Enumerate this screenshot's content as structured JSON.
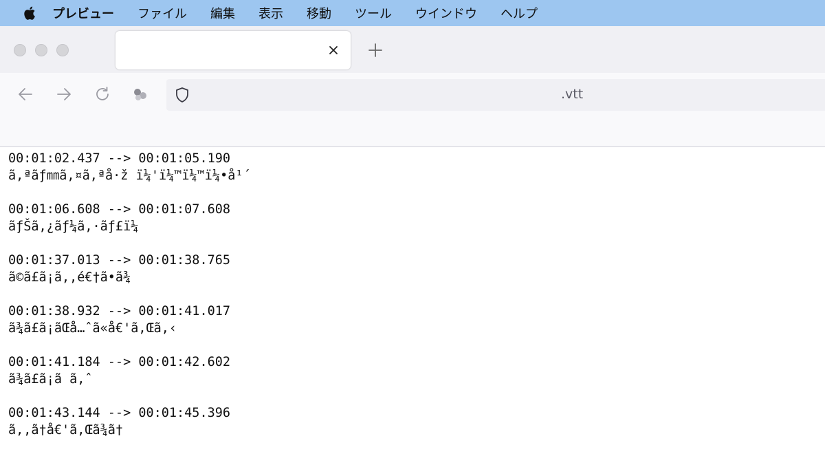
{
  "menubar": {
    "apple_icon": "apple-icon",
    "app_name": "プレビュー",
    "items": [
      "ファイル",
      "編集",
      "表示",
      "移動",
      "ツール",
      "ウインドウ",
      "ヘルプ"
    ]
  },
  "browser": {
    "tab": {
      "title": ""
    },
    "url": ".vtt"
  },
  "subtitles": [
    {
      "time": "00:01:02.437 --> 00:01:05.190",
      "text": "ã,ªãƒ㎜ã,¤ã,ªå·ž ï¼'ï¼™ï¼™ï¼•å¹´"
    },
    {
      "time": "00:01:06.608 --> 00:01:07.608",
      "text": "ãƒŠã,¿ãƒ¼ã,·ãƒ£ï¼"
    },
    {
      "time": "00:01:37.013 --> 00:01:38.765",
      "text": "ã©ã£ã¡ã,,é€†ã•ã¾"
    },
    {
      "time": "00:01:38.932 --> 00:01:41.017",
      "text": "ã¾ã£ã¡ãŒå…ˆã«å€'ã,Œã,‹"
    },
    {
      "time": "00:01:41.184 --> 00:01:42.602",
      "text": "ã¾ã£ã¡ã ã,ˆ"
    },
    {
      "time": "00:01:43.144 --> 00:01:45.396",
      "text": "ã,,ã†å€'ã,Œã¾ã†"
    }
  ]
}
